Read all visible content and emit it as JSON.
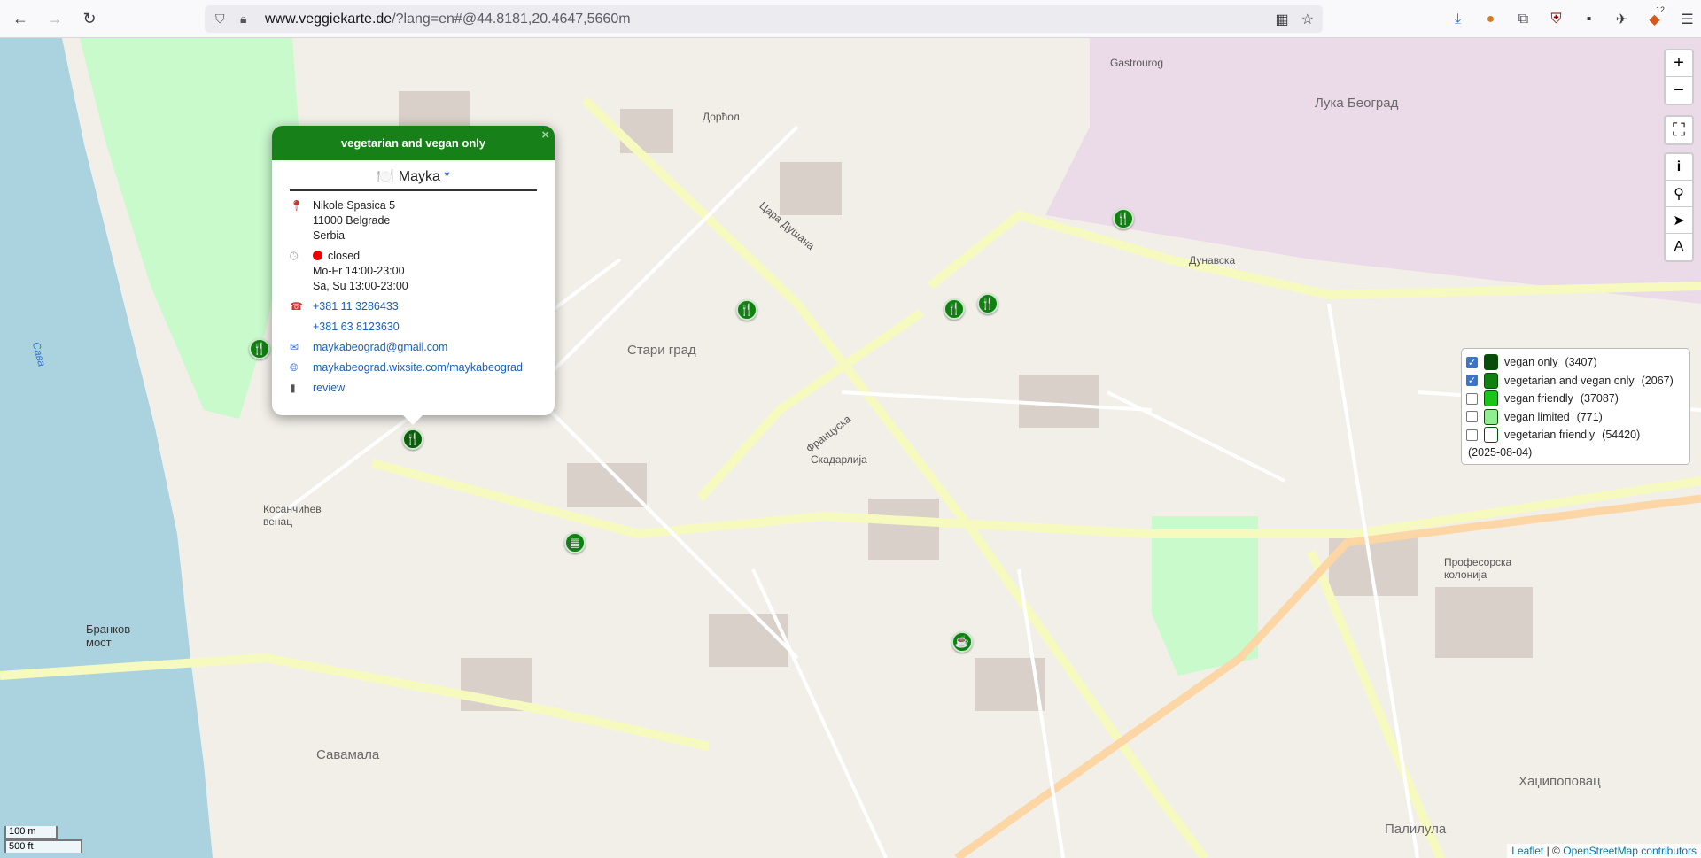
{
  "browser": {
    "url_host": "www.veggiekarte.de",
    "url_path": "/?lang=en#@44.8181,20.4647,5660m",
    "extension_badge": "12"
  },
  "map": {
    "labels": [
      {
        "id": "stari-grad",
        "text": "Стари град",
        "cls": "district"
      },
      {
        "id": "skadarlija",
        "text": "Скадарлија",
        "cls": ""
      },
      {
        "id": "savamala",
        "text": "Савамала",
        "cls": "district"
      },
      {
        "id": "palilula",
        "text": "Палилула",
        "cls": "district"
      },
      {
        "id": "kosancicev",
        "text": "Косанчићев венац",
        "cls": ""
      },
      {
        "id": "dorcol",
        "text": "Дорћол",
        "cls": ""
      },
      {
        "id": "gastrourog",
        "text": "Gastrourog",
        "cls": ""
      },
      {
        "id": "luka",
        "text": "Лука Београд",
        "cls": "district"
      },
      {
        "id": "brankov",
        "text": "Бранков мост",
        "cls": ""
      },
      {
        "id": "dunavska",
        "text": "Дунавска",
        "cls": ""
      },
      {
        "id": "cara-dusana",
        "text": "Цара Душана",
        "cls": ""
      },
      {
        "id": "francuska",
        "text": "Француска",
        "cls": ""
      },
      {
        "id": "hadzi",
        "text": "Хаџипоповац",
        "cls": "district"
      },
      {
        "id": "profesorska",
        "text": "Професорска колонија",
        "cls": ""
      },
      {
        "id": "sava",
        "text": "Сава",
        "cls": "water"
      }
    ],
    "zoom_in": "+",
    "zoom_out": "−",
    "scale_m": "100 m",
    "scale_ft": "500 ft",
    "attribution_leaflet": "Leaflet",
    "attribution_osm": "OpenStreetMap contributors",
    "attribution_sep": "| ©"
  },
  "popup": {
    "category": "vegetarian and vegan only",
    "close": "×",
    "icon": "🍽️",
    "name": "Mayka",
    "star": "*",
    "address": [
      "Nikole Spasica 5",
      "11000 Belgrade",
      "Serbia"
    ],
    "status": "closed",
    "hours": [
      "Mo-Fr 14:00-23:00",
      "Sa, Su 13:00-23:00"
    ],
    "phone1": "+381 11 3286433",
    "phone2": "+381 63 8123630",
    "email": "maykabeograd@gmail.com",
    "website": "maykabeograd.wixsite.com/maykabeograd",
    "review": "review"
  },
  "legend": {
    "items": [
      {
        "label": "vegan only",
        "count": "(3407)",
        "checked": true,
        "color": "#0a4d0a"
      },
      {
        "label": "vegetarian and vegan only",
        "count": "(2067)",
        "checked": true,
        "color": "#108110"
      },
      {
        "label": "vegan friendly",
        "count": "(37087)",
        "checked": false,
        "color": "#19c519"
      },
      {
        "label": "vegan limited",
        "count": "(771)",
        "checked": false,
        "color": "#90ee90"
      },
      {
        "label": "vegetarian friendly",
        "count": "(54420)",
        "checked": false,
        "color": "#ffffff"
      }
    ],
    "date": "(2025-08-04)"
  },
  "colors": {
    "popup_header": "#188018",
    "marker": "#108110",
    "water": "#aad3df",
    "park": "#c8facc",
    "industrial": "#ebdbe8"
  }
}
